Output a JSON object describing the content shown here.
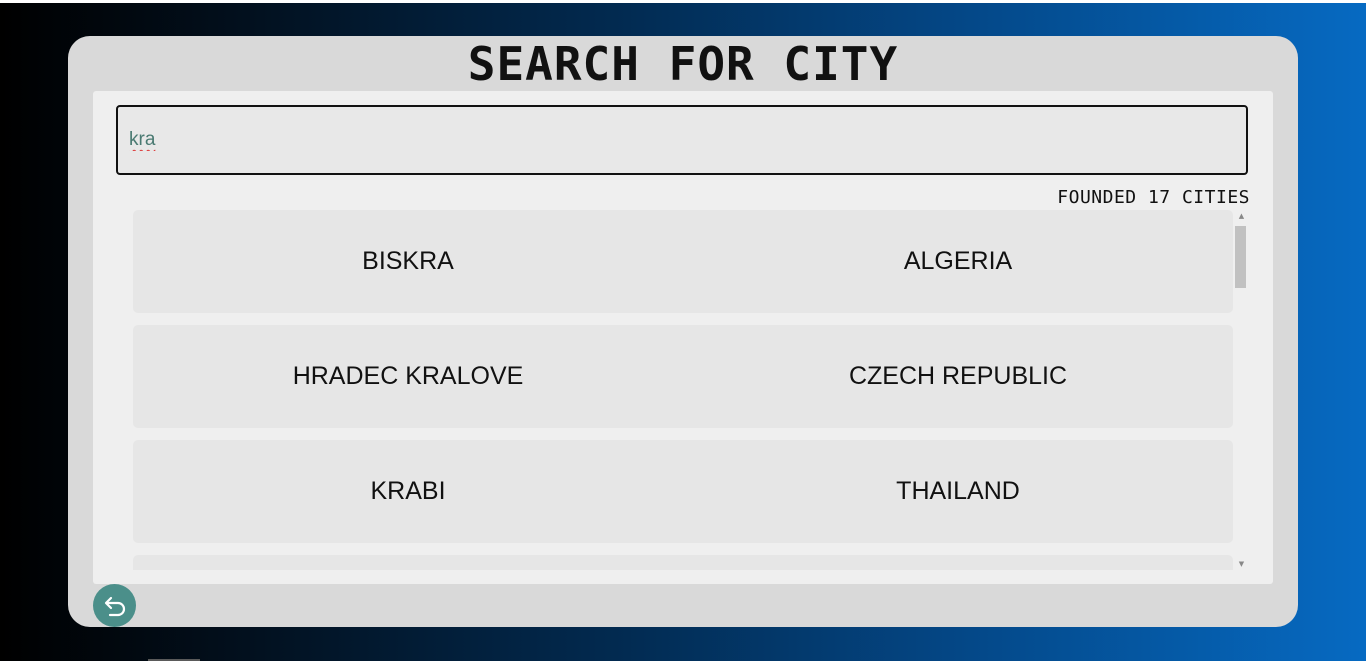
{
  "page": {
    "title": "SEARCH FOR CITY"
  },
  "search": {
    "value": "kra",
    "placeholder": ""
  },
  "results": {
    "count_text": "FOUNDED 17 CITIES",
    "items": [
      {
        "city": "BISKRA",
        "country": "ALGERIA"
      },
      {
        "city": "HRADEC KRALOVE",
        "country": "CZECH REPUBLIC"
      },
      {
        "city": "KRABI",
        "country": "THAILAND"
      },
      {
        "city": "",
        "country": ""
      }
    ]
  },
  "controls": {
    "back_icon": "back-arrow-icon",
    "scroll_up_icon": "triangle-up-icon",
    "scroll_down_icon": "triangle-down-icon"
  },
  "colors": {
    "accent": "#4b8f8a",
    "card": "#d9d9d9",
    "panel": "#efefef",
    "row": "#e6e6e6"
  }
}
